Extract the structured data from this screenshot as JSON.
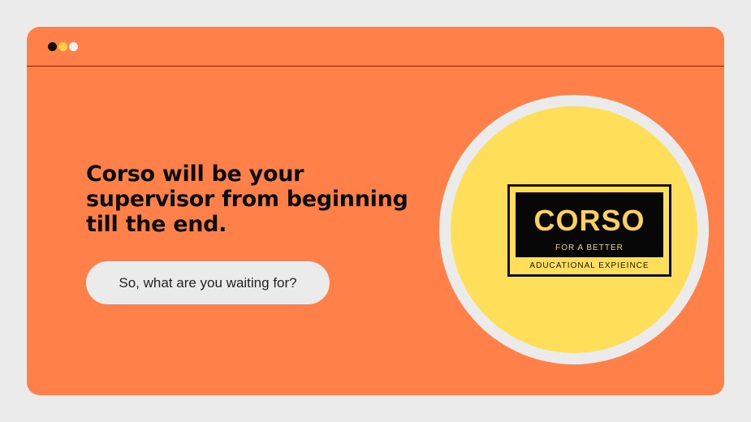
{
  "window": {
    "controls": [
      {
        "name": "close",
        "color": "#111111"
      },
      {
        "name": "minimize",
        "color": "#ffcf44"
      },
      {
        "name": "maximize",
        "color": "#f2f2f2"
      }
    ]
  },
  "content": {
    "headline": "Corso will be your supervisor from beginning till the end.",
    "cta_label": "So, what are you waiting for?"
  },
  "logo": {
    "word": "CORSO",
    "tagline_line1": "FOR A BETTER",
    "tagline_line2": "ADUCATIONAL EXPIEINCE"
  },
  "colors": {
    "page_background": "#ebebeb",
    "window_background": "#ff8149",
    "circle_fill": "#ffde59",
    "logo_text": "#ffd15c"
  }
}
